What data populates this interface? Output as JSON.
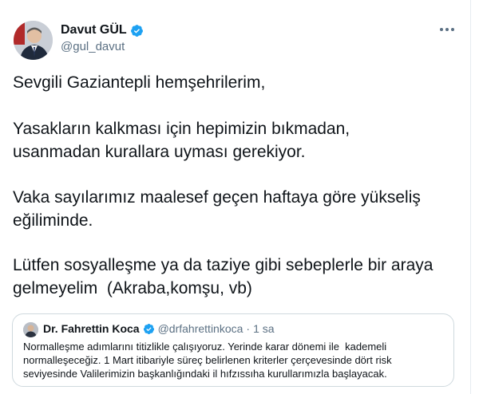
{
  "author": {
    "display_name": "Davut GÜL",
    "handle": "@gul_davut",
    "verified": true
  },
  "tweet": {
    "paragraphs": [
      [
        "Sevgili Gaziantepli hemşehrilerim,"
      ],
      [
        "Yasakların kalkması için hepimizin bıkmadan,",
        "usanmadan kurallara uyması gerekiyor."
      ],
      [
        "Vaka sayılarımız maalesef geçen haftaya göre yükseliş",
        "eğiliminde."
      ],
      [
        "Lütfen sosyalleşme ya da taziye gibi sebeplerle bir araya",
        "gelmeyelim  (Akraba,komşu, vb)"
      ]
    ]
  },
  "quoted_tweet": {
    "display_name": "Dr. Fahrettin Koca",
    "handle": "@drfahrettinkoca",
    "separator": "·",
    "time": "1 sa",
    "verified": true,
    "lines": [
      "Normalleşme adımlarını titizlikle çalışıyoruz. Yerinde karar dönemi ile  kademeli",
      "normalleşeceğiz. 1 Mart itibariyle süreç belirlenen kriterler çerçevesinde dört risk",
      "seviyesinde Valilerimizin başkanlığındaki il hıfzıssıha kurullarımızla başlayacak."
    ]
  },
  "icons": {
    "verified": "verified-badge-icon",
    "more": "more-options-icon"
  },
  "colors": {
    "text_primary": "#0f1419",
    "text_secondary": "#5b7083",
    "verified_blue": "#1da1f2",
    "border": "#cfd9de"
  }
}
